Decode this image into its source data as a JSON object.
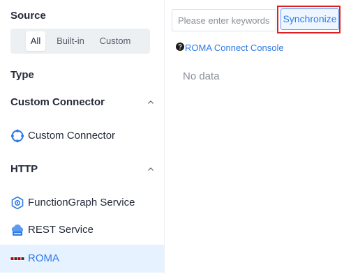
{
  "left_panel": {
    "source_title": "Source",
    "source_tabs": [
      {
        "label": "All",
        "active": true
      },
      {
        "label": "Built-in",
        "active": false
      },
      {
        "label": "Custom",
        "active": false
      }
    ],
    "type_title": "Type",
    "groups": [
      {
        "label": "Custom Connector",
        "expanded": true,
        "items": [
          {
            "label": "Custom Connector",
            "icon": "custom-connector-icon",
            "selected": false
          }
        ]
      },
      {
        "label": "HTTP",
        "expanded": true,
        "items": [
          {
            "label": "FunctionGraph Service",
            "icon": "functiongraph-icon",
            "selected": false
          },
          {
            "label": "REST Service",
            "icon": "rest-service-icon",
            "selected": false
          },
          {
            "label": "ROMA",
            "icon": "roma-logo-icon",
            "selected": true
          }
        ]
      }
    ]
  },
  "right_panel": {
    "search": {
      "value": "",
      "placeholder": "Please enter keywords"
    },
    "sync_label": "Synchronize",
    "console_link": "ROMA Connect Console",
    "empty_text": "No data"
  },
  "colors": {
    "accent": "#2f7ae5",
    "selected_bg": "#e6f2ff",
    "highlight_box": "#e02020",
    "text": "#252b3a",
    "muted": "#8a8e99"
  }
}
